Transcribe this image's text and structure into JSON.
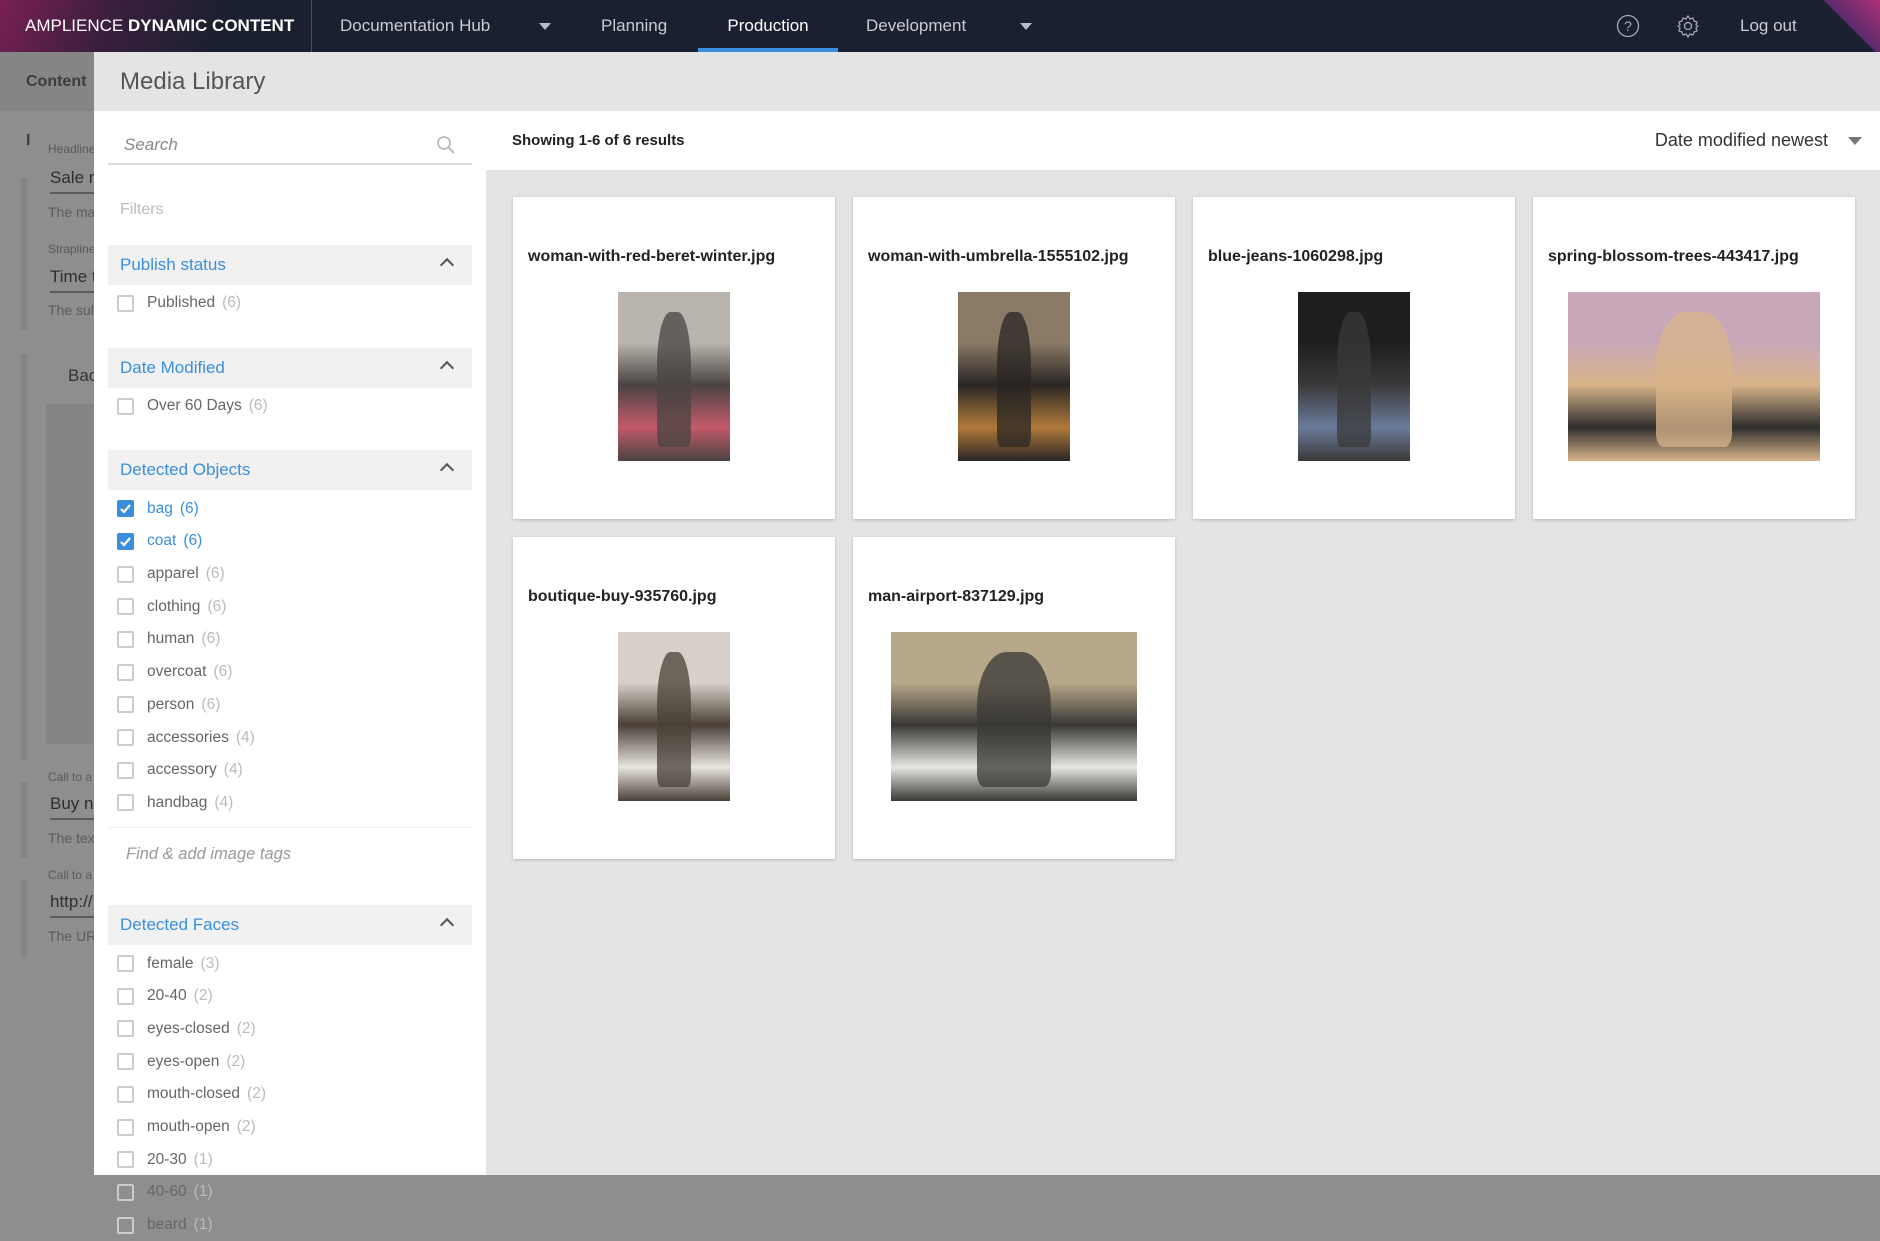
{
  "nav": {
    "logo_light": "AMPLIENCE",
    "logo_bold": "DYNAMIC CONTENT",
    "hub": "Documentation Hub",
    "items": [
      {
        "label": "Planning"
      },
      {
        "label": "Production",
        "active": true
      },
      {
        "label": "Development"
      }
    ],
    "logout": "Log out",
    "accent": "#3a8fdc"
  },
  "background": {
    "header": "Content I",
    "fields": [
      {
        "label": "Headline",
        "value": "Sale n",
        "help": "The ma"
      },
      {
        "label": "Strapline",
        "value": "Time t",
        "help": "The sul"
      },
      {
        "label": "Bac"
      },
      {
        "label": "Call to a",
        "value": "Buy n",
        "help": "The tex"
      },
      {
        "label": "Call to a",
        "value": "http://",
        "help": "The UR"
      }
    ]
  },
  "modal": {
    "title": "Media Library"
  },
  "sidebar": {
    "search_placeholder": "Search",
    "filters_label": "Filters",
    "tag_placeholder": "Find & add image tags",
    "sections": [
      {
        "title": "Publish status",
        "items": [
          {
            "label": "Published",
            "count": "(6)",
            "checked": false
          }
        ]
      },
      {
        "title": "Date Modified",
        "items": [
          {
            "label": "Over 60 Days",
            "count": "(6)",
            "checked": false
          }
        ]
      },
      {
        "title": "Detected Objects",
        "items": [
          {
            "label": "bag",
            "count": "(6)",
            "checked": true
          },
          {
            "label": "coat",
            "count": "(6)",
            "checked": true
          },
          {
            "label": "apparel",
            "count": "(6)",
            "checked": false
          },
          {
            "label": "clothing",
            "count": "(6)",
            "checked": false
          },
          {
            "label": "human",
            "count": "(6)",
            "checked": false
          },
          {
            "label": "overcoat",
            "count": "(6)",
            "checked": false
          },
          {
            "label": "person",
            "count": "(6)",
            "checked": false
          },
          {
            "label": "accessories",
            "count": "(4)",
            "checked": false
          },
          {
            "label": "accessory",
            "count": "(4)",
            "checked": false
          },
          {
            "label": "handbag",
            "count": "(4)",
            "checked": false
          }
        ]
      },
      {
        "title": "Detected Faces",
        "items": [
          {
            "label": "female",
            "count": "(3)",
            "checked": false
          },
          {
            "label": "20-40",
            "count": "(2)",
            "checked": false
          },
          {
            "label": "eyes-closed",
            "count": "(2)",
            "checked": false
          },
          {
            "label": "eyes-open",
            "count": "(2)",
            "checked": false
          },
          {
            "label": "mouth-closed",
            "count": "(2)",
            "checked": false
          },
          {
            "label": "mouth-open",
            "count": "(2)",
            "checked": false
          },
          {
            "label": "20-30",
            "count": "(1)",
            "checked": false
          },
          {
            "label": "40-60",
            "count": "(1)",
            "checked": false
          },
          {
            "label": "beard",
            "count": "(1)",
            "checked": false
          }
        ]
      }
    ]
  },
  "results": {
    "showing": "Showing 1-6 of 6 results",
    "sort": "Date modified newest",
    "assets": [
      {
        "name": "woman-with-red-beret-winter.jpg",
        "orientation": "portrait",
        "colors": [
          "#b9b4ad",
          "#4a4442",
          "#c45a6a"
        ]
      },
      {
        "name": "woman-with-umbrella-1555102.jpg",
        "orientation": "portrait",
        "colors": [
          "#8a7a66",
          "#2a2624",
          "#b07a3a"
        ]
      },
      {
        "name": "blue-jeans-1060298.jpg",
        "orientation": "portrait",
        "colors": [
          "#1e1e1e",
          "#3a3a3a",
          "#6a7a9a"
        ]
      },
      {
        "name": "spring-blossom-trees-443417.jpg",
        "orientation": "landscape",
        "colors": [
          "#c8a8b8",
          "#d9b48a",
          "#2e2e2e"
        ]
      },
      {
        "name": "boutique-buy-935760.jpg",
        "orientation": "portrait",
        "colors": [
          "#d8d0c8",
          "#4a4038",
          "#e8e4de"
        ]
      },
      {
        "name": "man-airport-837129.jpg",
        "orientation": "landscape",
        "colors": [
          "#b8a88a",
          "#3a3836",
          "#e8e6e2"
        ]
      }
    ]
  }
}
